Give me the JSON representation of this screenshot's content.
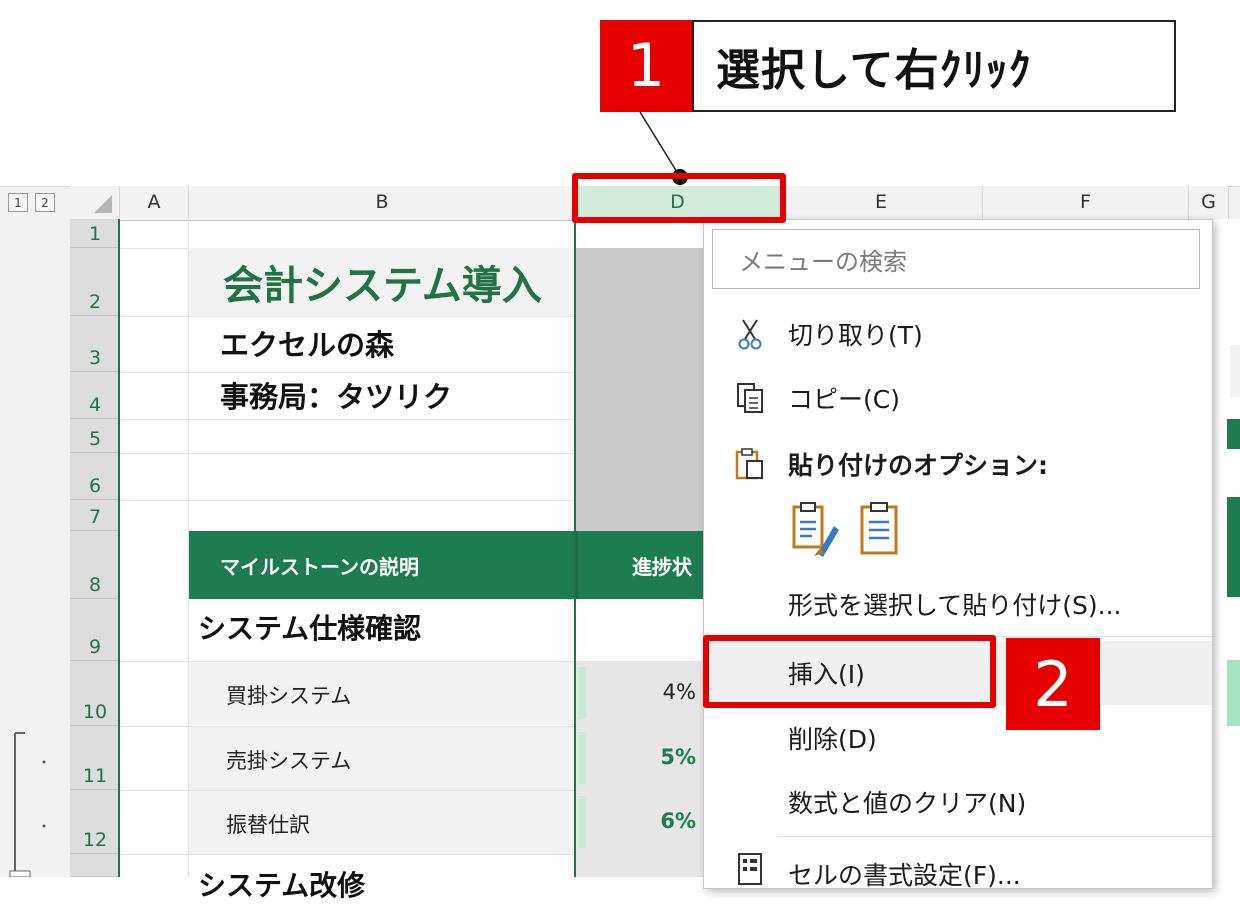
{
  "callout1": {
    "number": "1",
    "text": "選択して右ｸﾘｯｸ"
  },
  "callout2": {
    "number": "2"
  },
  "outline_levels": [
    "1",
    "2"
  ],
  "columns": [
    "A",
    "B",
    "D",
    "E",
    "F",
    "G"
  ],
  "rows": [
    "1",
    "2",
    "3",
    "4",
    "5",
    "6",
    "7",
    "8",
    "9",
    "10",
    "11",
    "12"
  ],
  "sheet": {
    "title": "会計システム導入",
    "company": "エクセルの森",
    "office": "事務局：タツリク",
    "header_col_b": "マイルストーンの説明",
    "header_col_d": "進捗状",
    "section1": "システム仕様確認",
    "tasks": [
      {
        "label": "買掛システム",
        "pct": "4%"
      },
      {
        "label": "売掛システム",
        "pct": "5%"
      },
      {
        "label": "振替仕訳",
        "pct": "6%"
      }
    ],
    "section2_partial": "システム改修"
  },
  "context_menu": {
    "search_placeholder": "メニューの検索",
    "items": {
      "cut": "切り取り(T)",
      "copy": "コピー(C)",
      "paste_options": "貼り付けのオプション:",
      "paste_special": "形式を選択して貼り付け(S)...",
      "insert": "挿入(I)",
      "delete": "削除(D)",
      "clear": "数式と値のクリア(N)",
      "format_cells": "セルの書式設定(F)..."
    }
  },
  "colors": {
    "accent_red": "#e60000",
    "excel_green": "#217346",
    "header_green": "#1e7c52"
  }
}
